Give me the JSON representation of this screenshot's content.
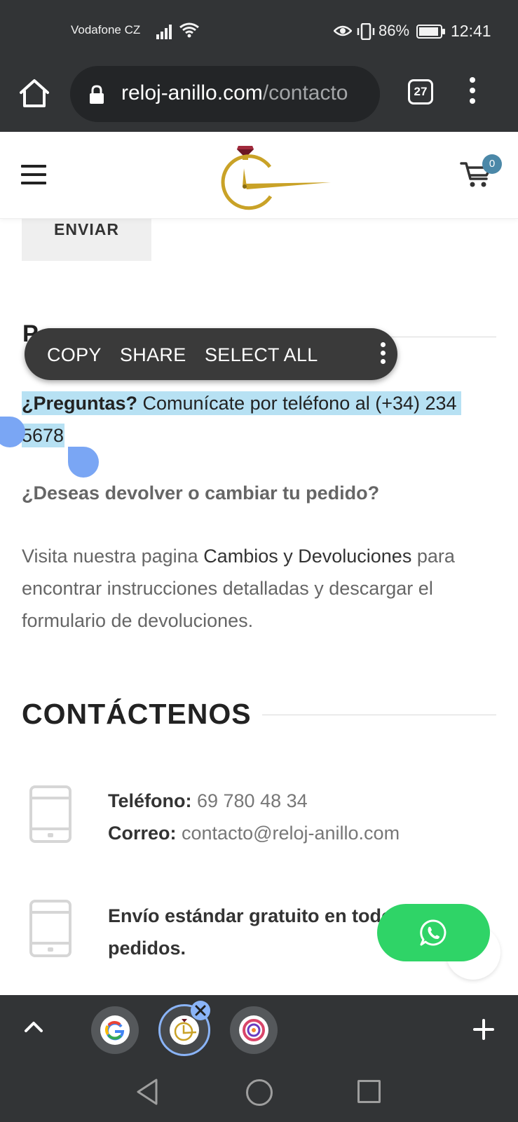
{
  "status_bar": {
    "carrier": "Vodafone CZ",
    "battery_percent": "86%",
    "time": "12:41"
  },
  "browser": {
    "url_domain": "reloj-anillo.com",
    "url_path": "/contacto",
    "tab_count": "27"
  },
  "header": {
    "cart_count": "0"
  },
  "form": {
    "submit_label": "ENVIAR"
  },
  "selection_toolbar": {
    "copy": "COPY",
    "share": "SHARE",
    "select_all": "SELECT ALL"
  },
  "content": {
    "questions_bold": "¿Preguntas?",
    "questions_line1": " Comunícate por teléfono al (+34) 234",
    "questions_line2": "5678",
    "returns_heading": "¿Deseas devolver o cambiar tu pedido?",
    "returns_text_pre": "Visita nuestra pagina ",
    "returns_link": "Cambios y Devoluciones",
    "returns_text_post": " para encontrar instrucciones detalladas y descargar el formulario de devoluciones."
  },
  "contact": {
    "heading": "CONTÁCTENOS",
    "phone_label": "Teléfono:",
    "phone_value": " 69 780 48 34",
    "email_label": "Correo:",
    "email_value": " contacto@reloj-anillo.com",
    "shipping_text": "Envío estándar gratuito en todos los pedidos."
  },
  "icons": [
    "home-icon",
    "lock-icon",
    "overflow-menu-icon",
    "hamburger-icon",
    "cart-icon",
    "whatsapp-icon",
    "tablet-icon",
    "chevron-up-icon",
    "plus-icon",
    "close-icon",
    "google-icon",
    "back-icon"
  ],
  "colors": {
    "chrome_bg": "#323436",
    "selection_highlight": "#b7e1f3",
    "whatsapp_green": "#2fd467",
    "cart_badge": "#4b88a8",
    "logo_gold": "#c9a227"
  }
}
